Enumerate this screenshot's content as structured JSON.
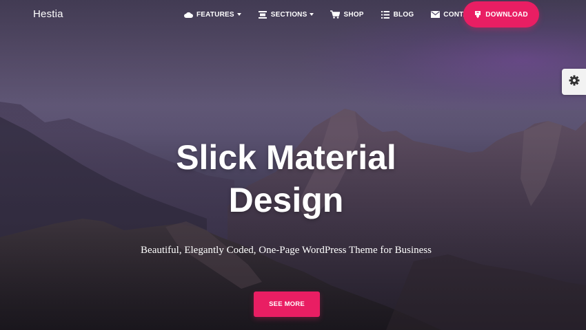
{
  "brand": {
    "name": "Hestia"
  },
  "nav": {
    "items": [
      {
        "label": "FEATURES",
        "icon": "cloud-icon",
        "has_dropdown": true
      },
      {
        "label": "SECTIONS",
        "icon": "sections-icon",
        "has_dropdown": true
      },
      {
        "label": "SHOP",
        "icon": "cart-icon",
        "has_dropdown": false
      },
      {
        "label": "BLOG",
        "icon": "list-icon",
        "has_dropdown": false
      },
      {
        "label": "CONTACT",
        "icon": "envelope-icon",
        "has_dropdown": false
      }
    ],
    "download_label": "DOWNLOAD",
    "download_icon": "download-icon"
  },
  "settings": {
    "icon": "gear-icon"
  },
  "hero": {
    "title_line1": "Slick Material",
    "title_line2": "Design",
    "subtitle": "Beautiful, Elegantly Coded, One-Page WordPress Theme for Business",
    "cta_label": "SEE MORE"
  },
  "colors": {
    "accent": "#e91e63",
    "text": "#ffffff",
    "settings_bg": "#f2f2f2"
  }
}
